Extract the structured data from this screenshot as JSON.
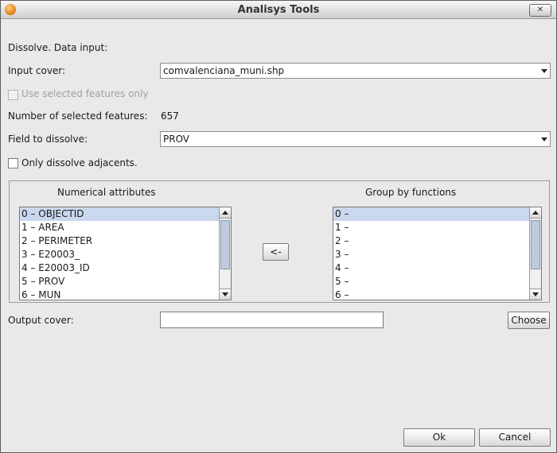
{
  "window": {
    "title": "Analisys Tools",
    "close_label": "✕"
  },
  "form": {
    "section_label": "Dissolve. Data input:",
    "input_cover_label": "Input cover:",
    "input_cover_value": "comvalenciana_muni.shp",
    "use_selected_label": "Use selected features only",
    "selected_count_label": "Number of selected features:",
    "selected_count_value": "657",
    "field_label": "Field to dissolve:",
    "field_value": "PROV",
    "adjacent_label": "Only dissolve adjacents.",
    "output_label": "Output cover:",
    "output_value": "",
    "choose_label": "Choose"
  },
  "attributes": {
    "title": "Numerical attributes",
    "items": [
      "0 – OBJECTID",
      "1 – AREA",
      "2 – PERIMETER",
      "3 – E20003_",
      "4 – E20003_ID",
      "5 – PROV",
      "6 – MUN"
    ]
  },
  "functions": {
    "title": "Group by functions",
    "items": [
      "0 –",
      "1 –",
      "2 –",
      "3 –",
      "4 –",
      "5 –",
      "6 –"
    ]
  },
  "move_button_label": "<-",
  "footer": {
    "ok_label": "Ok",
    "cancel_label": "Cancel"
  }
}
